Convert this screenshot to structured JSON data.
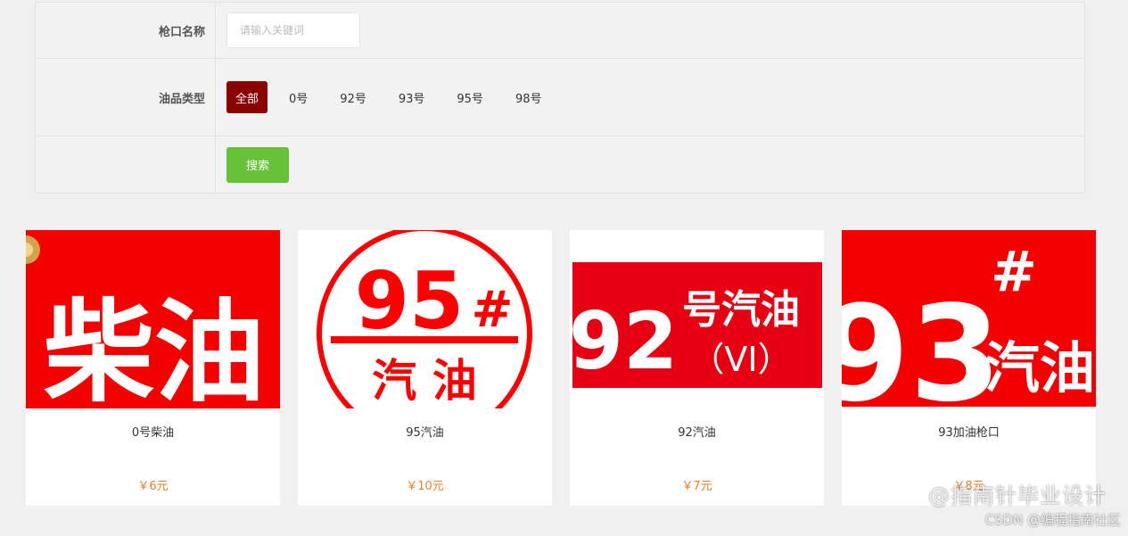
{
  "filter": {
    "name_label": "枪口名称",
    "name_placeholder": "请输入关键词",
    "name_value": "",
    "type_label": "油品类型",
    "types": [
      "全部",
      "0号",
      "92号",
      "93号",
      "95号",
      "98号"
    ],
    "selected_type": "全部",
    "search_label": "搜索"
  },
  "products": [
    {
      "name": "0号柴油",
      "price": "￥6元",
      "image_text": [
        "柴油"
      ]
    },
    {
      "name": "95汽油",
      "price": "￥10元",
      "image_text": [
        "95",
        "#",
        "汽 油"
      ]
    },
    {
      "name": "92汽油",
      "price": "￥7元",
      "image_text": [
        "92",
        "号汽油",
        "（VI）"
      ]
    },
    {
      "name": "93加油枪口",
      "price": "￥8元",
      "image_text": [
        "93",
        "#",
        "汽油"
      ]
    }
  ],
  "watermark": {
    "line1": "@指南针毕业设计",
    "line2": "CSDN @编程指南社区"
  },
  "colors": {
    "accent_red": "#8b0000",
    "search_green": "#67c23a",
    "price_orange": "#e6812b",
    "banner_red": "#f50000"
  }
}
